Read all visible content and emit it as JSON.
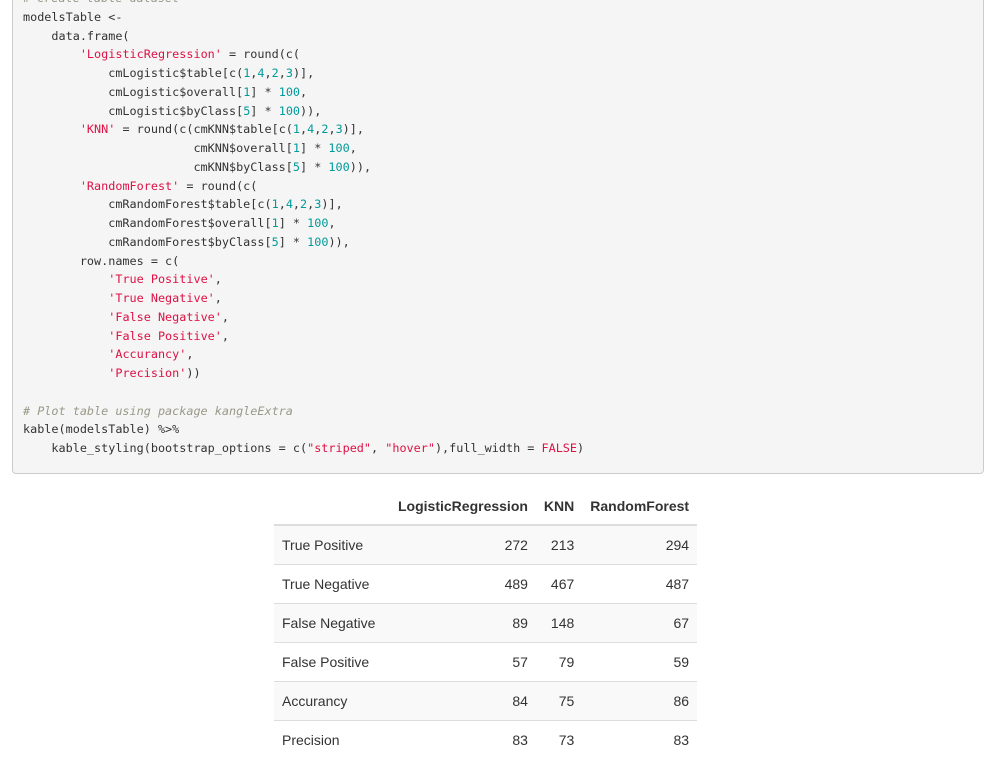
{
  "code_lines": [
    [
      {
        "t": "comment",
        "s": "# Create table dataset"
      }
    ],
    [
      {
        "t": "plain",
        "s": "modelsTable <-"
      }
    ],
    [
      {
        "t": "plain",
        "s": "    data.frame("
      }
    ],
    [
      {
        "t": "plain",
        "s": "        "
      },
      {
        "t": "string",
        "s": "'LogisticRegression'"
      },
      {
        "t": "plain",
        "s": " = round(c("
      }
    ],
    [
      {
        "t": "plain",
        "s": "            cmLogistic$table[c("
      },
      {
        "t": "number",
        "s": "1"
      },
      {
        "t": "plain",
        "s": ","
      },
      {
        "t": "number",
        "s": "4"
      },
      {
        "t": "plain",
        "s": ","
      },
      {
        "t": "number",
        "s": "2"
      },
      {
        "t": "plain",
        "s": ","
      },
      {
        "t": "number",
        "s": "3"
      },
      {
        "t": "plain",
        "s": ")],"
      }
    ],
    [
      {
        "t": "plain",
        "s": "            cmLogistic$overall["
      },
      {
        "t": "number",
        "s": "1"
      },
      {
        "t": "plain",
        "s": "] * "
      },
      {
        "t": "number",
        "s": "100"
      },
      {
        "t": "plain",
        "s": ","
      }
    ],
    [
      {
        "t": "plain",
        "s": "            cmLogistic$byClass["
      },
      {
        "t": "number",
        "s": "5"
      },
      {
        "t": "plain",
        "s": "] * "
      },
      {
        "t": "number",
        "s": "100"
      },
      {
        "t": "plain",
        "s": ")),"
      }
    ],
    [
      {
        "t": "plain",
        "s": "        "
      },
      {
        "t": "string",
        "s": "'KNN'"
      },
      {
        "t": "plain",
        "s": " = round(c(cmKNN$table[c("
      },
      {
        "t": "number",
        "s": "1"
      },
      {
        "t": "plain",
        "s": ","
      },
      {
        "t": "number",
        "s": "4"
      },
      {
        "t": "plain",
        "s": ","
      },
      {
        "t": "number",
        "s": "2"
      },
      {
        "t": "plain",
        "s": ","
      },
      {
        "t": "number",
        "s": "3"
      },
      {
        "t": "plain",
        "s": ")],"
      }
    ],
    [
      {
        "t": "plain",
        "s": "                        cmKNN$overall["
      },
      {
        "t": "number",
        "s": "1"
      },
      {
        "t": "plain",
        "s": "] * "
      },
      {
        "t": "number",
        "s": "100"
      },
      {
        "t": "plain",
        "s": ","
      }
    ],
    [
      {
        "t": "plain",
        "s": "                        cmKNN$byClass["
      },
      {
        "t": "number",
        "s": "5"
      },
      {
        "t": "plain",
        "s": "] * "
      },
      {
        "t": "number",
        "s": "100"
      },
      {
        "t": "plain",
        "s": ")),"
      }
    ],
    [
      {
        "t": "plain",
        "s": "        "
      },
      {
        "t": "string",
        "s": "'RandomForest'"
      },
      {
        "t": "plain",
        "s": " = round(c("
      }
    ],
    [
      {
        "t": "plain",
        "s": "            cmRandomForest$table[c("
      },
      {
        "t": "number",
        "s": "1"
      },
      {
        "t": "plain",
        "s": ","
      },
      {
        "t": "number",
        "s": "4"
      },
      {
        "t": "plain",
        "s": ","
      },
      {
        "t": "number",
        "s": "2"
      },
      {
        "t": "plain",
        "s": ","
      },
      {
        "t": "number",
        "s": "3"
      },
      {
        "t": "plain",
        "s": ")],"
      }
    ],
    [
      {
        "t": "plain",
        "s": "            cmRandomForest$overall["
      },
      {
        "t": "number",
        "s": "1"
      },
      {
        "t": "plain",
        "s": "] * "
      },
      {
        "t": "number",
        "s": "100"
      },
      {
        "t": "plain",
        "s": ","
      }
    ],
    [
      {
        "t": "plain",
        "s": "            cmRandomForest$byClass["
      },
      {
        "t": "number",
        "s": "5"
      },
      {
        "t": "plain",
        "s": "] * "
      },
      {
        "t": "number",
        "s": "100"
      },
      {
        "t": "plain",
        "s": ")),"
      }
    ],
    [
      {
        "t": "plain",
        "s": "        row.names = c("
      }
    ],
    [
      {
        "t": "plain",
        "s": "            "
      },
      {
        "t": "string",
        "s": "'True Positive'"
      },
      {
        "t": "plain",
        "s": ","
      }
    ],
    [
      {
        "t": "plain",
        "s": "            "
      },
      {
        "t": "string",
        "s": "'True Negative'"
      },
      {
        "t": "plain",
        "s": ","
      }
    ],
    [
      {
        "t": "plain",
        "s": "            "
      },
      {
        "t": "string",
        "s": "'False Negative'"
      },
      {
        "t": "plain",
        "s": ","
      }
    ],
    [
      {
        "t": "plain",
        "s": "            "
      },
      {
        "t": "string",
        "s": "'False Positive'"
      },
      {
        "t": "plain",
        "s": ","
      }
    ],
    [
      {
        "t": "plain",
        "s": "            "
      },
      {
        "t": "string",
        "s": "'Accurancy'"
      },
      {
        "t": "plain",
        "s": ","
      }
    ],
    [
      {
        "t": "plain",
        "s": "            "
      },
      {
        "t": "string",
        "s": "'Precision'"
      },
      {
        "t": "plain",
        "s": "))"
      }
    ],
    [
      {
        "t": "plain",
        "s": ""
      }
    ],
    [
      {
        "t": "comment",
        "s": "# Plot table using package kangleExtra"
      }
    ],
    [
      {
        "t": "plain",
        "s": "kable(modelsTable) %>%"
      }
    ],
    [
      {
        "t": "plain",
        "s": "    kable_styling(bootstrap_options = c("
      },
      {
        "t": "string",
        "s": "\"striped\""
      },
      {
        "t": "plain",
        "s": ", "
      },
      {
        "t": "string",
        "s": "\"hover\""
      },
      {
        "t": "plain",
        "s": "),full_width = "
      },
      {
        "t": "string",
        "s": "FALSE"
      },
      {
        "t": "plain",
        "s": ")"
      }
    ]
  ],
  "table": {
    "headers": [
      "",
      "LogisticRegression",
      "KNN",
      "RandomForest"
    ],
    "rows": [
      {
        "label": "True Positive",
        "values": [
          "272",
          "213",
          "294"
        ]
      },
      {
        "label": "True Negative",
        "values": [
          "489",
          "467",
          "487"
        ]
      },
      {
        "label": "False Negative",
        "values": [
          "89",
          "148",
          "67"
        ]
      },
      {
        "label": "False Positive",
        "values": [
          "57",
          "79",
          "59"
        ]
      },
      {
        "label": "Accurancy",
        "values": [
          "84",
          "75",
          "86"
        ]
      },
      {
        "label": "Precision",
        "values": [
          "83",
          "73",
          "83"
        ]
      }
    ]
  },
  "colors": {
    "code_bg": "#f5f5f5",
    "comment": "#999988",
    "string": "#dd1144",
    "number": "#009999",
    "text": "#333333"
  }
}
